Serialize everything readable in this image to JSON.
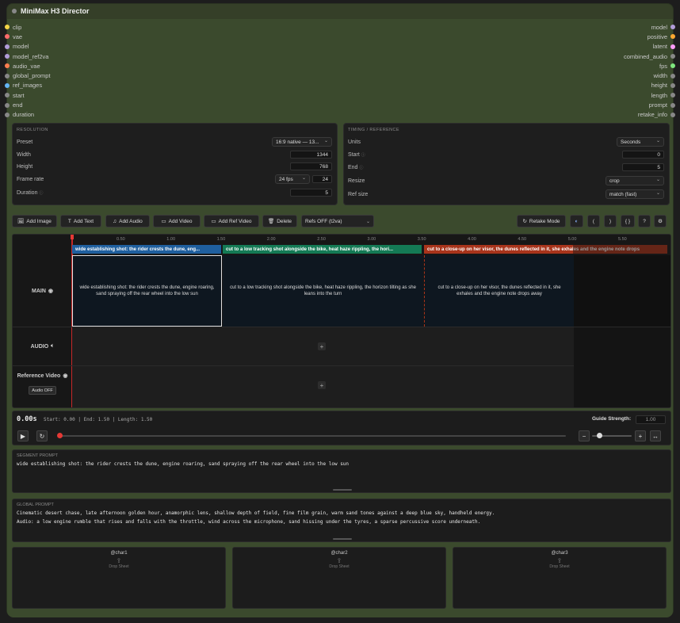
{
  "title": "MiniMax H3 Director",
  "inputs": [
    {
      "label": "clip",
      "color": "#f5d547"
    },
    {
      "label": "vae",
      "color": "#ff6b6b"
    },
    {
      "label": "model",
      "color": "#b19cd9"
    },
    {
      "label": "model_ref2va",
      "color": "#b19cd9"
    },
    {
      "label": "audio_vae",
      "color": "#ff7f50"
    },
    {
      "label": "global_prompt",
      "color": "#888888"
    },
    {
      "label": "ref_images",
      "color": "#64b5f6"
    },
    {
      "label": "start",
      "color": "#888888"
    },
    {
      "label": "end",
      "color": "#888888"
    },
    {
      "label": "duration",
      "color": "#888888"
    }
  ],
  "outputs": [
    {
      "label": "model",
      "color": "#b19cd9"
    },
    {
      "label": "positive",
      "color": "#ffa931"
    },
    {
      "label": "latent",
      "color": "#ff9cf9"
    },
    {
      "label": "combined_audio",
      "color": "#888888"
    },
    {
      "label": "fps",
      "color": "#7fe87f"
    },
    {
      "label": "width",
      "color": "#888888"
    },
    {
      "label": "height",
      "color": "#888888"
    },
    {
      "label": "length",
      "color": "#888888"
    },
    {
      "label": "prompt",
      "color": "#888888"
    },
    {
      "label": "retake_info",
      "color": "#888888"
    }
  ],
  "resolution": {
    "title": "RESOLUTION",
    "preset_label": "Preset",
    "preset_value": "16:9 native — 13...",
    "width_label": "Width",
    "width_value": "1344",
    "height_label": "Height",
    "height_value": "768",
    "framerate_label": "Frame rate",
    "fps_select": "24 fps",
    "fps_value": "24",
    "duration_label": "Duration",
    "duration_value": "5"
  },
  "timing": {
    "title": "TIMING / REFERENCE",
    "units_label": "Units",
    "units_value": "Seconds",
    "start_label": "Start",
    "start_value": "0",
    "end_label": "End",
    "end_value": "5",
    "resize_label": "Resize",
    "resize_value": "crop",
    "refsize_label": "Ref size",
    "refsize_value": "match (fast)"
  },
  "toolbar": {
    "add_image": "Add Image",
    "add_text": "Add Text",
    "add_audio": "Add Audio",
    "add_video": "Add Video",
    "add_ref_video": "Add Ref Video",
    "delete": "Delete",
    "refs_select": "Refs OFF (t2va)",
    "retake_mode": "Retake Mode",
    "b1": "(",
    "b2": ")",
    "b3": "{ }",
    "b4": "?"
  },
  "ruler": [
    "0.50",
    "1.00",
    "1.50",
    "2.00",
    "2.50",
    "3.00",
    "3.50",
    "4.00",
    "4.50",
    "5.00",
    "5.50"
  ],
  "segments": [
    {
      "tag": "wide establishing shot: the rider crests the dune, eng...",
      "text": "wide establishing shot: the rider crests the dune, engine roaring, sand spraying off the rear wheel into the low sun",
      "color": "#1f5f9e"
    },
    {
      "tag": "cut to a low tracking shot alongside the bike, heat haze rippling, the hori...",
      "text": "cut to a low tracking shot alongside the bike, heat haze rippling, the horizon tilting as she leans into the turn",
      "color": "#147a55"
    },
    {
      "tag": "cut to a close-up on her visor, the dunes reflected in it, she exhales and the engine note drops",
      "text": "cut to a close-up on her visor, the dunes reflected in it, she exhales and the engine note drops away",
      "color": "#a8341b"
    }
  ],
  "tracks": {
    "main": "MAIN",
    "audio": "AUDIO",
    "refvideo": "Reference Video",
    "audio_off": "Audio OFF"
  },
  "transport": {
    "time": "0.00s",
    "info": "Start: 0.00 | End: 1.50 | Length: 1.50",
    "guide_label": "Guide Strength:",
    "guide_value": "1.00"
  },
  "segment_prompt": {
    "title": "SEGMENT PROMPT",
    "text": "wide establishing shot: the rider crests the dune, engine roaring, sand spraying off the rear wheel into the low sun"
  },
  "global_prompt": {
    "title": "GLOBAL PROMPT",
    "line1": "Cinematic desert chase, late afternoon golden hour, anamorphic lens, shallow depth of field, fine film grain, warm sand tones against a deep blue sky, handheld energy.",
    "line2": "Audio: a low engine rumble that rises and falls with the throttle, wind across the microphone, sand hissing under the tyres, a sparse percussive score underneath."
  },
  "chars": [
    {
      "name": "@char1",
      "drop": "Drop Sheet"
    },
    {
      "name": "@char2",
      "drop": "Drop Sheet"
    },
    {
      "name": "@char3",
      "drop": "Drop Sheet"
    }
  ]
}
